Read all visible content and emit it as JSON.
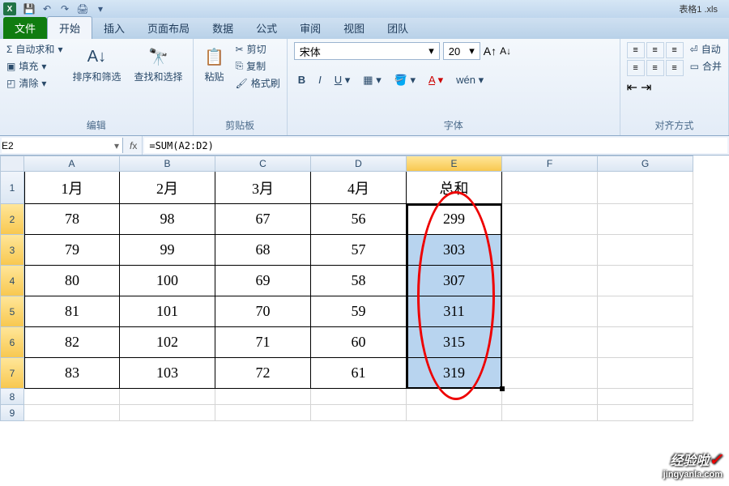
{
  "title_file": "表格1 .xls",
  "tabs": {
    "file": "文件",
    "home": "开始",
    "insert": "插入",
    "layout": "页面布局",
    "data": "数据",
    "formulas": "公式",
    "review": "审阅",
    "view": "视图",
    "team": "团队"
  },
  "ribbon": {
    "edit": {
      "autosum": "自动求和",
      "fill": "填充",
      "clear": "清除",
      "sort_filter": "排序和筛选",
      "find_select": "查找和选择",
      "label": "编辑"
    },
    "clipboard": {
      "paste": "粘贴",
      "cut": "剪切",
      "copy": "复制",
      "format_painter": "格式刷",
      "label": "剪贴板"
    },
    "font": {
      "name": "宋体",
      "size": "20",
      "label": "字体"
    },
    "align": {
      "auto_wrap": "自动",
      "merge": "合并",
      "label": "对齐方式"
    }
  },
  "namebox": "E2",
  "formula": "=SUM(A2:D2)",
  "columns": [
    "A",
    "B",
    "C",
    "D",
    "E",
    "F",
    "G"
  ],
  "col_widths": {
    "A": 118,
    "B": 118,
    "C": 118,
    "D": 118,
    "E": 118,
    "F": 118,
    "G": 118
  },
  "row_heights": {
    "1": 40,
    "data": 38,
    "empty": 20
  },
  "headers": {
    "c1": "1月",
    "c2": "2月",
    "c3": "3月",
    "c4": "4月",
    "c5": "总和"
  },
  "chart_data": {
    "type": "table",
    "columns": [
      "1月",
      "2月",
      "3月",
      "4月",
      "总和"
    ],
    "rows": [
      [
        78,
        98,
        67,
        56,
        299
      ],
      [
        79,
        99,
        68,
        57,
        303
      ],
      [
        80,
        100,
        69,
        58,
        307
      ],
      [
        81,
        101,
        70,
        59,
        311
      ],
      [
        82,
        102,
        71,
        60,
        315
      ],
      [
        83,
        103,
        72,
        61,
        319
      ]
    ]
  },
  "selection": {
    "active_cell": "E2",
    "range": "E2:E7"
  },
  "watermark": {
    "main": "经验啦",
    "sub": "jingyanla.com"
  }
}
